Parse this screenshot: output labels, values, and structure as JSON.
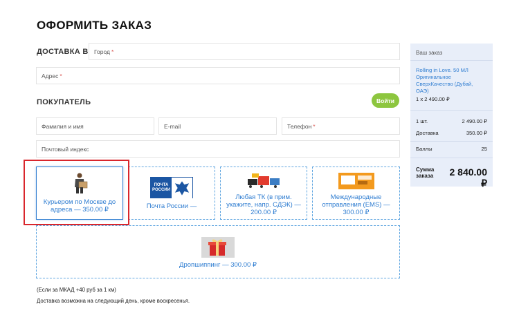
{
  "page": {
    "title": "ОФОРМИТЬ ЗАКАЗ"
  },
  "delivery": {
    "label": "ДОСТАВКА В",
    "city_placeholder": "Город",
    "address_placeholder": "Адрес",
    "required_mark": "*"
  },
  "buyer": {
    "label": "ПОКУПАТЕЛЬ",
    "login_label": "Войти",
    "name_placeholder": "Фамилия и имя",
    "email_placeholder": "E-mail",
    "phone_placeholder": "Телефон",
    "zip_placeholder": "Почтовый индекс"
  },
  "shipping_options": [
    {
      "label": "Курьером по Москве до адреса — 350.00 ₽",
      "icon": "courier-icon",
      "selected": true
    },
    {
      "label": "Почта России —",
      "icon": "russian-post-logo",
      "logo_text_1": "ПОЧТА",
      "logo_text_2": "РОССИИ",
      "selected": false
    },
    {
      "label": "Любая ТК (в прим. укажите, напр. СДЭК) — 200.00 ₽",
      "icon": "delivery-trucks-icon",
      "selected": false
    },
    {
      "label": "Международные отправления (EMS) — 300.00 ₽",
      "icon": "ems-parcel-icon",
      "selected": false
    },
    {
      "label": "Дропшиппинг — 300.00 ₽",
      "icon": "gift-box-icon",
      "selected": false
    }
  ],
  "notes": {
    "mkad": "(Если за МКАД +40 руб за 1 км)",
    "next_day": "Доставка возможна на следующий день, кроме воскресенья."
  },
  "summary": {
    "title": "Ваш заказ",
    "product_name": "Rolling in Love. 50 МЛ Оригинальное СверхКачество (Дубай, ОАЭ)",
    "product_qty": "1 x 2 490.00 ₽",
    "rows": [
      {
        "label": "1 шт.",
        "value": "2 490.00 ₽"
      },
      {
        "label": "Доставка",
        "value": "350.00 ₽"
      },
      {
        "label": "Баллы",
        "value": "25"
      }
    ],
    "total_label_1": "Сумма",
    "total_label_2": "заказа",
    "total_value": "2 840.00 ₽"
  },
  "colors": {
    "accent_blue": "#2f7dd1",
    "button_green": "#8dc63f",
    "highlight_red": "#d9262c",
    "summary_bg": "#e8eef9"
  }
}
